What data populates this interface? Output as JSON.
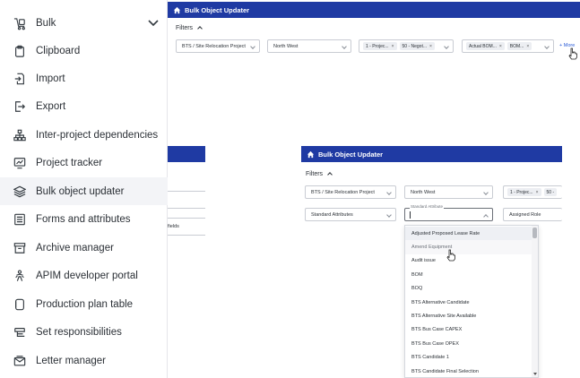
{
  "sidebar": {
    "header": {
      "label": "Bulk",
      "icon": "bulk-icon"
    },
    "items": [
      {
        "label": "Clipboard",
        "icon": "clipboard-icon"
      },
      {
        "label": "Import",
        "icon": "import-icon"
      },
      {
        "label": "Export",
        "icon": "export-icon"
      },
      {
        "label": "Inter-project dependencies",
        "icon": "hierarchy-icon"
      },
      {
        "label": "Project tracker",
        "icon": "chart-monitor-icon"
      },
      {
        "label": "Bulk object updater",
        "icon": "layers-icon",
        "active": true
      },
      {
        "label": "Forms and attributes",
        "icon": "form-icon"
      },
      {
        "label": "Archive manager",
        "icon": "archive-icon"
      },
      {
        "label": "APIM developer portal",
        "icon": "developer-icon"
      },
      {
        "label": "Production plan table",
        "icon": "table-icon"
      },
      {
        "label": "Set responsibilities",
        "icon": "responsibilities-icon"
      },
      {
        "label": "Letter manager",
        "icon": "letter-icon"
      }
    ]
  },
  "top_window": {
    "title": "Bulk Object Updater",
    "filters_label": "Filters",
    "project_select": "BTS / Site Relocation Project",
    "region_select": "North West",
    "chips_group1": [
      "1 - Projec...",
      "50 - Negot..."
    ],
    "chips_group2": [
      "Actual BOM...",
      "BOM..."
    ],
    "more_link": "+ More"
  },
  "left_panel": {
    "truncated_text": "fields"
  },
  "second_window": {
    "title": "Bulk Object Updater",
    "filters_label": "Filters",
    "project_select": "BTS / Site Relocation Project",
    "region_select": "North West",
    "chips": [
      "1 - Projec...",
      "50 -"
    ],
    "attributes_select": "Standard Attributes",
    "search_field_label": "Standard Attribute",
    "assigned_role": "Assigned Role",
    "dropdown_options": [
      "Adjusted Proposed Lease Rate",
      "Amend Equipment",
      "Audit issue",
      "BOM",
      "BOQ",
      "BTS Alternative Candidate",
      "BTS Alternative Site Available",
      "BTS Bus Case CAPEX",
      "BTS Bus Case OPEX",
      "BTS Candidate 1",
      "BTS Candidate Final Selection"
    ]
  },
  "colors": {
    "title_bar": "#1f3aa3",
    "link": "#2a5bd7",
    "active_item_bg": "#f3f4f7"
  }
}
